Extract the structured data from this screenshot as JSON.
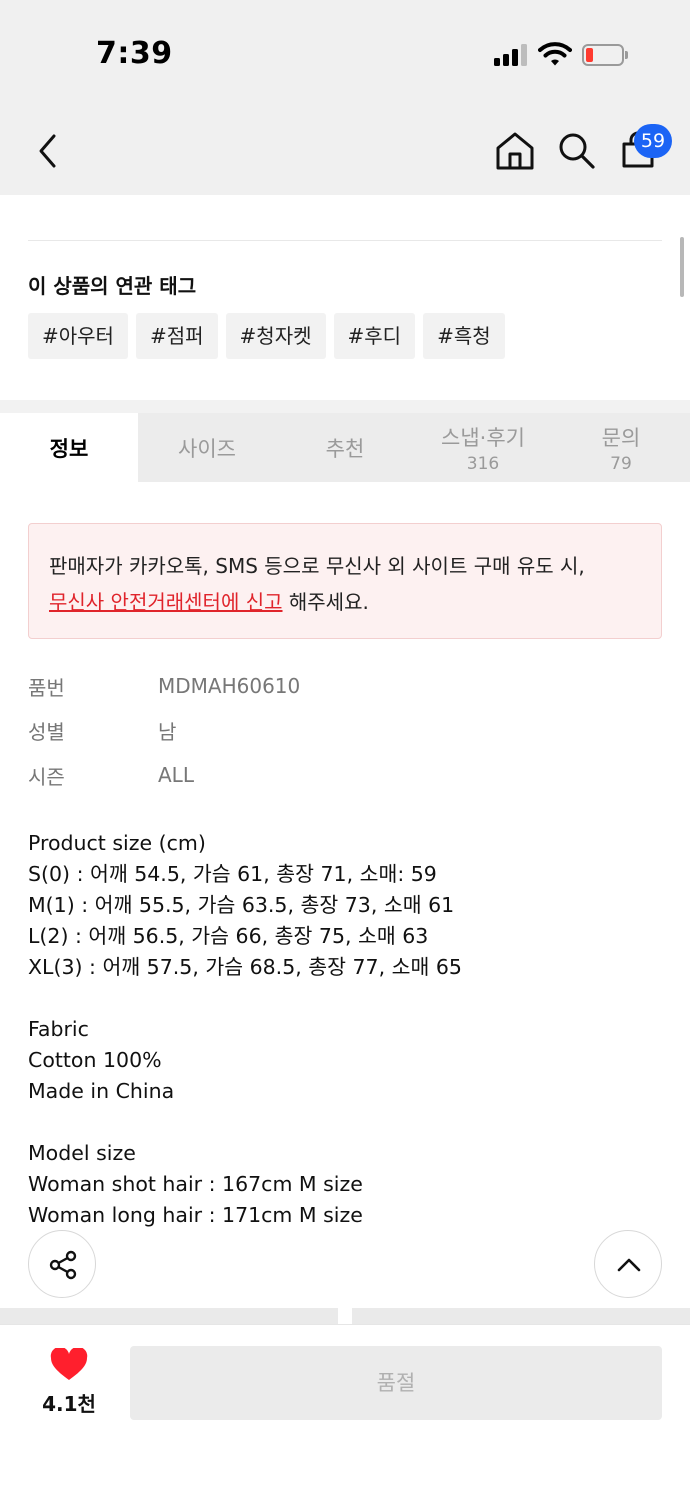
{
  "status_bar": {
    "time": "7:39"
  },
  "header": {
    "cart_count": "59"
  },
  "tags_section": {
    "title": "이 상품의 연관 태그",
    "tags": [
      "#아우터",
      "#점퍼",
      "#청자켓",
      "#후디",
      "#흑청"
    ]
  },
  "tabs": [
    {
      "label": "정보",
      "count": ""
    },
    {
      "label": "사이즈",
      "count": ""
    },
    {
      "label": "추천",
      "count": ""
    },
    {
      "label": "스냅·후기",
      "count": "316"
    },
    {
      "label": "문의",
      "count": "79"
    }
  ],
  "notice": {
    "line1": "판매자가 카카오톡, SMS 등으로 무신사 외 사이트 구매 유도 시,",
    "link": "무신사 안전거래센터에 신고",
    "suffix": " 해주세요."
  },
  "info": [
    {
      "key": "품번",
      "value": "MDMAH60610"
    },
    {
      "key": "성별",
      "value": "남"
    },
    {
      "key": "시즌",
      "value": "ALL"
    }
  ],
  "description": {
    "lines": [
      "Product size (cm)",
      "S(0) : 어깨 54.5, 가슴 61, 총장 71, 소매: 59",
      "M(1) : 어깨 55.5, 가슴 63.5, 총장 73, 소매 61",
      "L(2) : 어깨 56.5, 가슴 66, 총장 75, 소매 63",
      "XL(3) : 어깨 57.5, 가슴 68.5, 총장 77, 소매 65",
      "",
      "Fabric",
      "Cotton 100%",
      "Made in China",
      "",
      "Model size",
      "Woman shot hair : 167cm M size",
      "Woman long hair : 171cm M size"
    ]
  },
  "bottom_bar": {
    "like_count": "4.1천",
    "buy_label": "품절"
  },
  "colors": {
    "accent_blue": "#1b64f5",
    "heart_red": "#ff1f2d",
    "notice_red": "#e0242b",
    "battery_red": "#ff3b30"
  }
}
